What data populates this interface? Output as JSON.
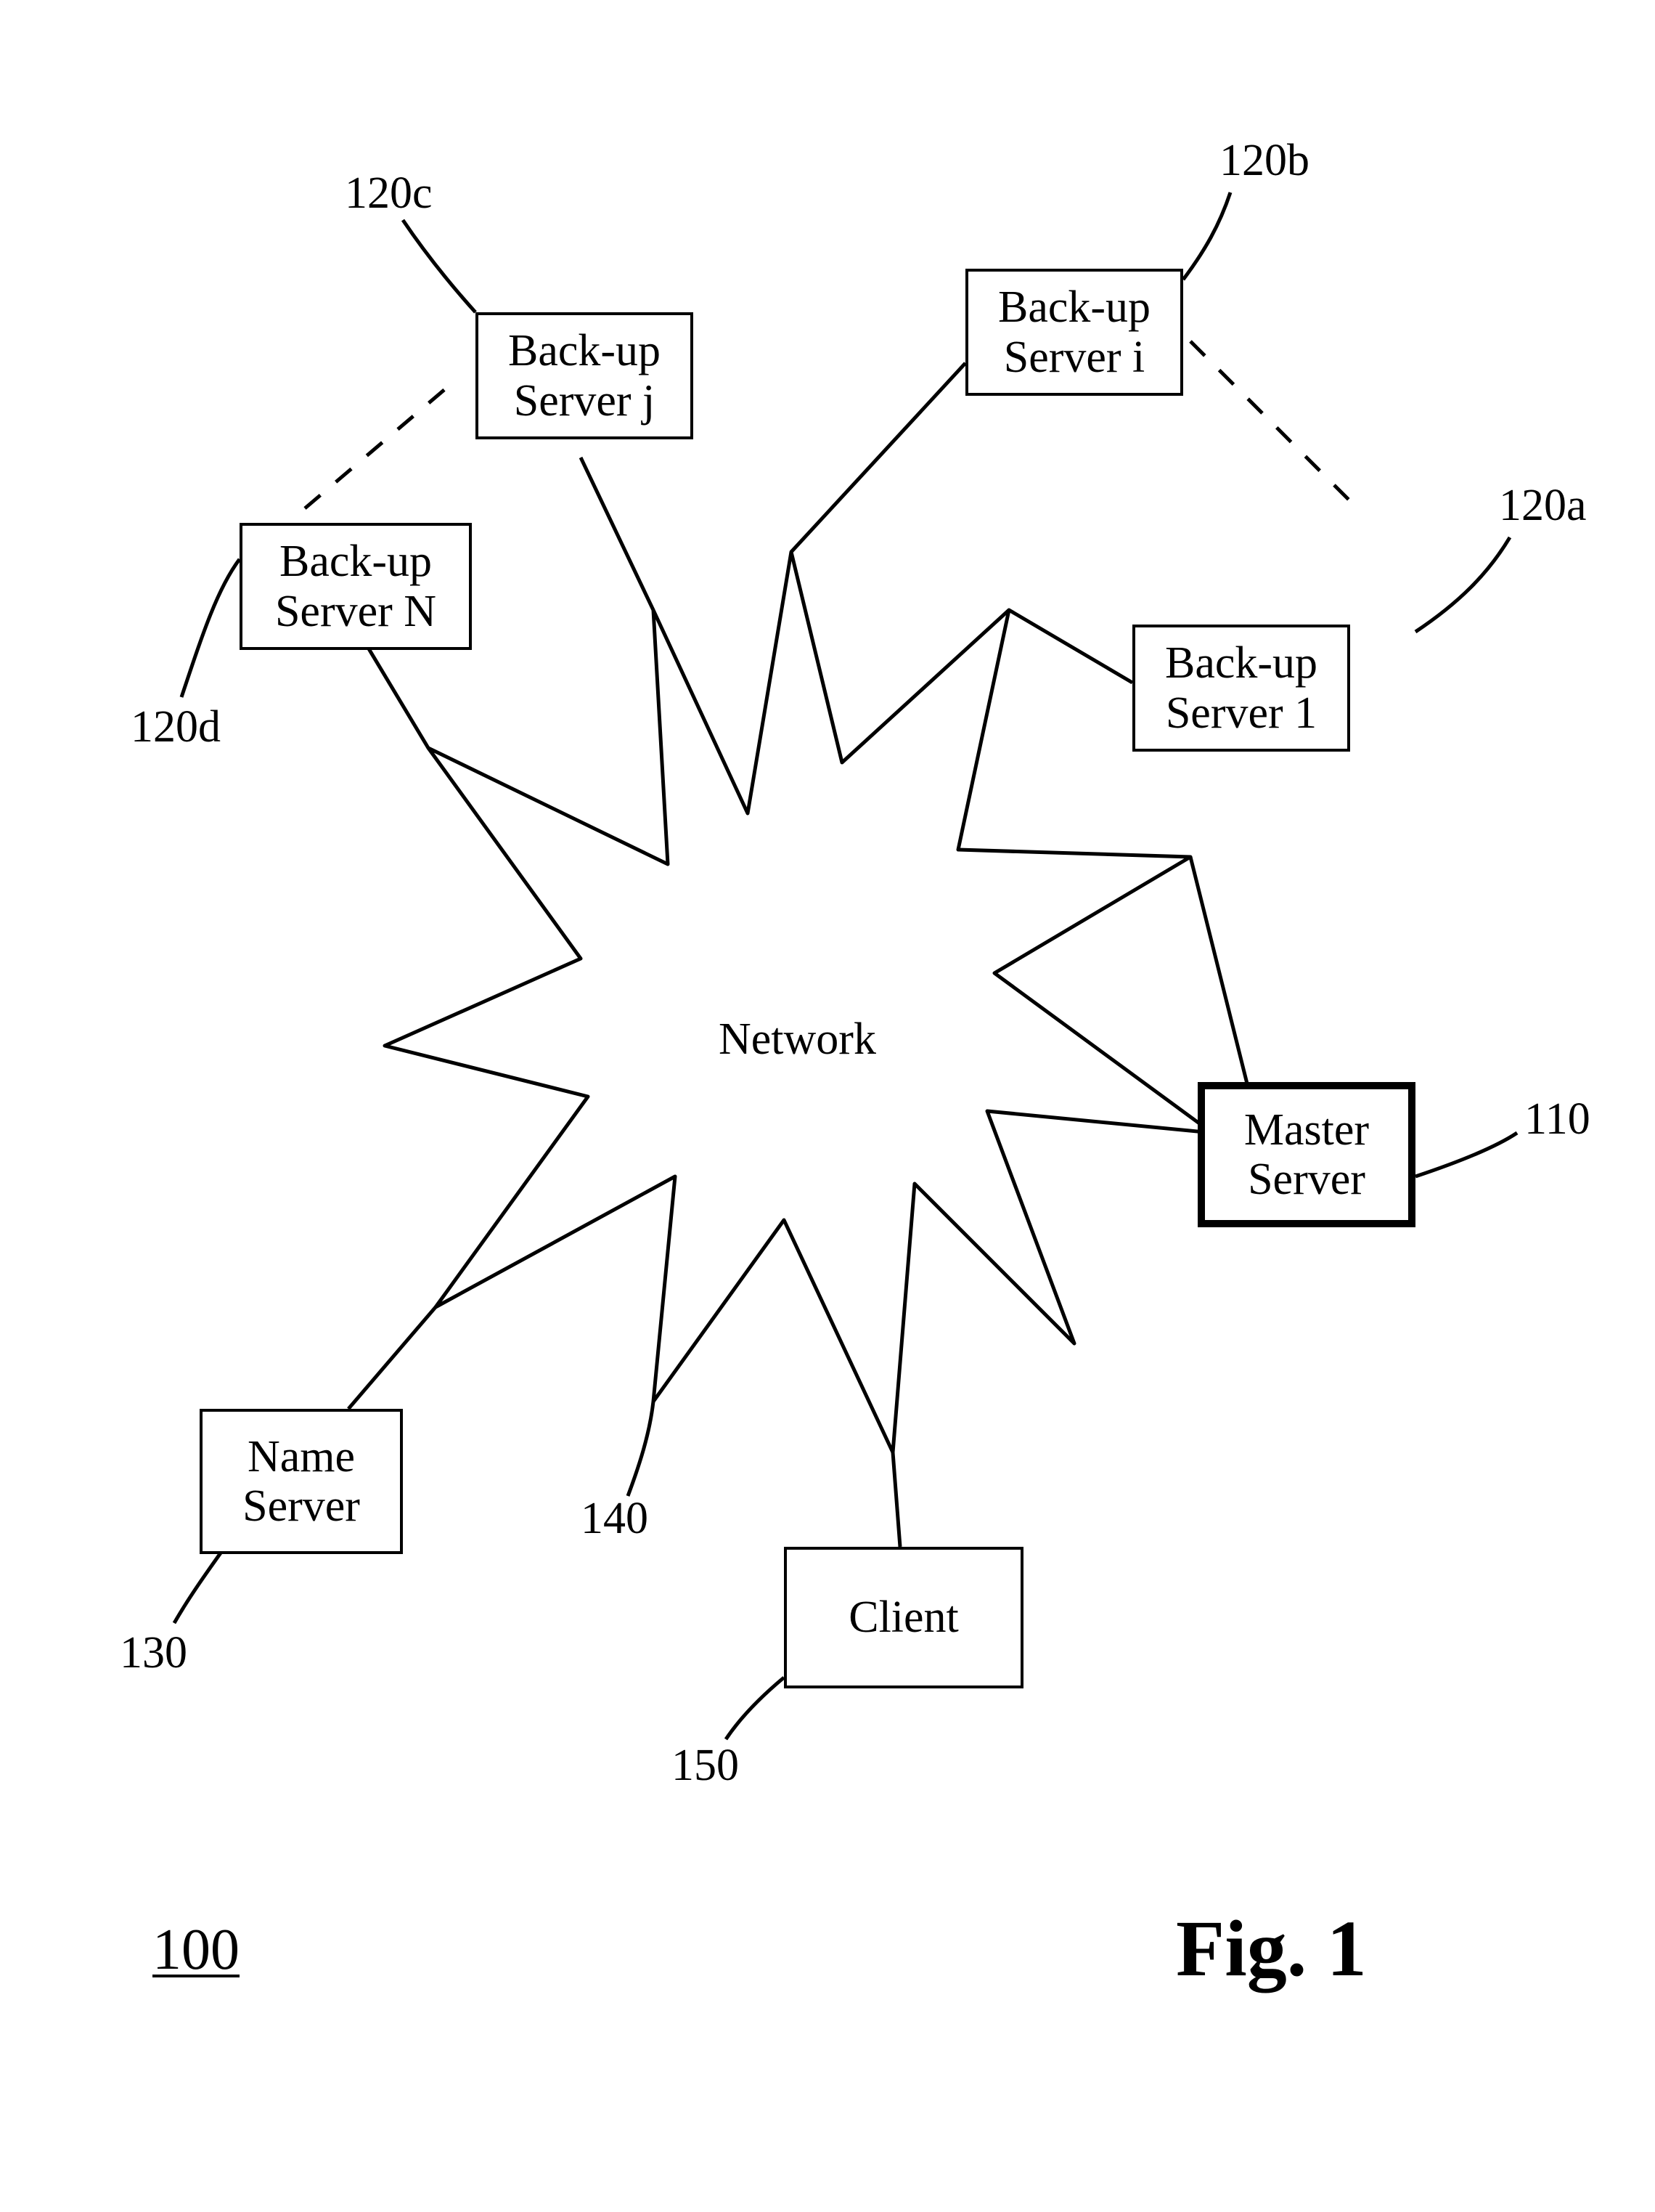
{
  "figure_label": "Fig. 1",
  "diagram_id": "100",
  "network_label": "Network",
  "nodes": {
    "master": {
      "text": "Master\nServer",
      "ref": "110"
    },
    "backup1": {
      "text": "Back-up\nServer 1",
      "ref": "120a"
    },
    "backupi": {
      "text": "Back-up\nServer i",
      "ref": "120b"
    },
    "backupj": {
      "text": "Back-up\nServer j",
      "ref": "120c"
    },
    "backupN": {
      "text": "Back-up\nServer N",
      "ref": "120d"
    },
    "name": {
      "text": "Name\nServer",
      "ref": "130"
    },
    "client": {
      "text": "Client",
      "ref": "150"
    },
    "network": {
      "ref": "140"
    }
  }
}
